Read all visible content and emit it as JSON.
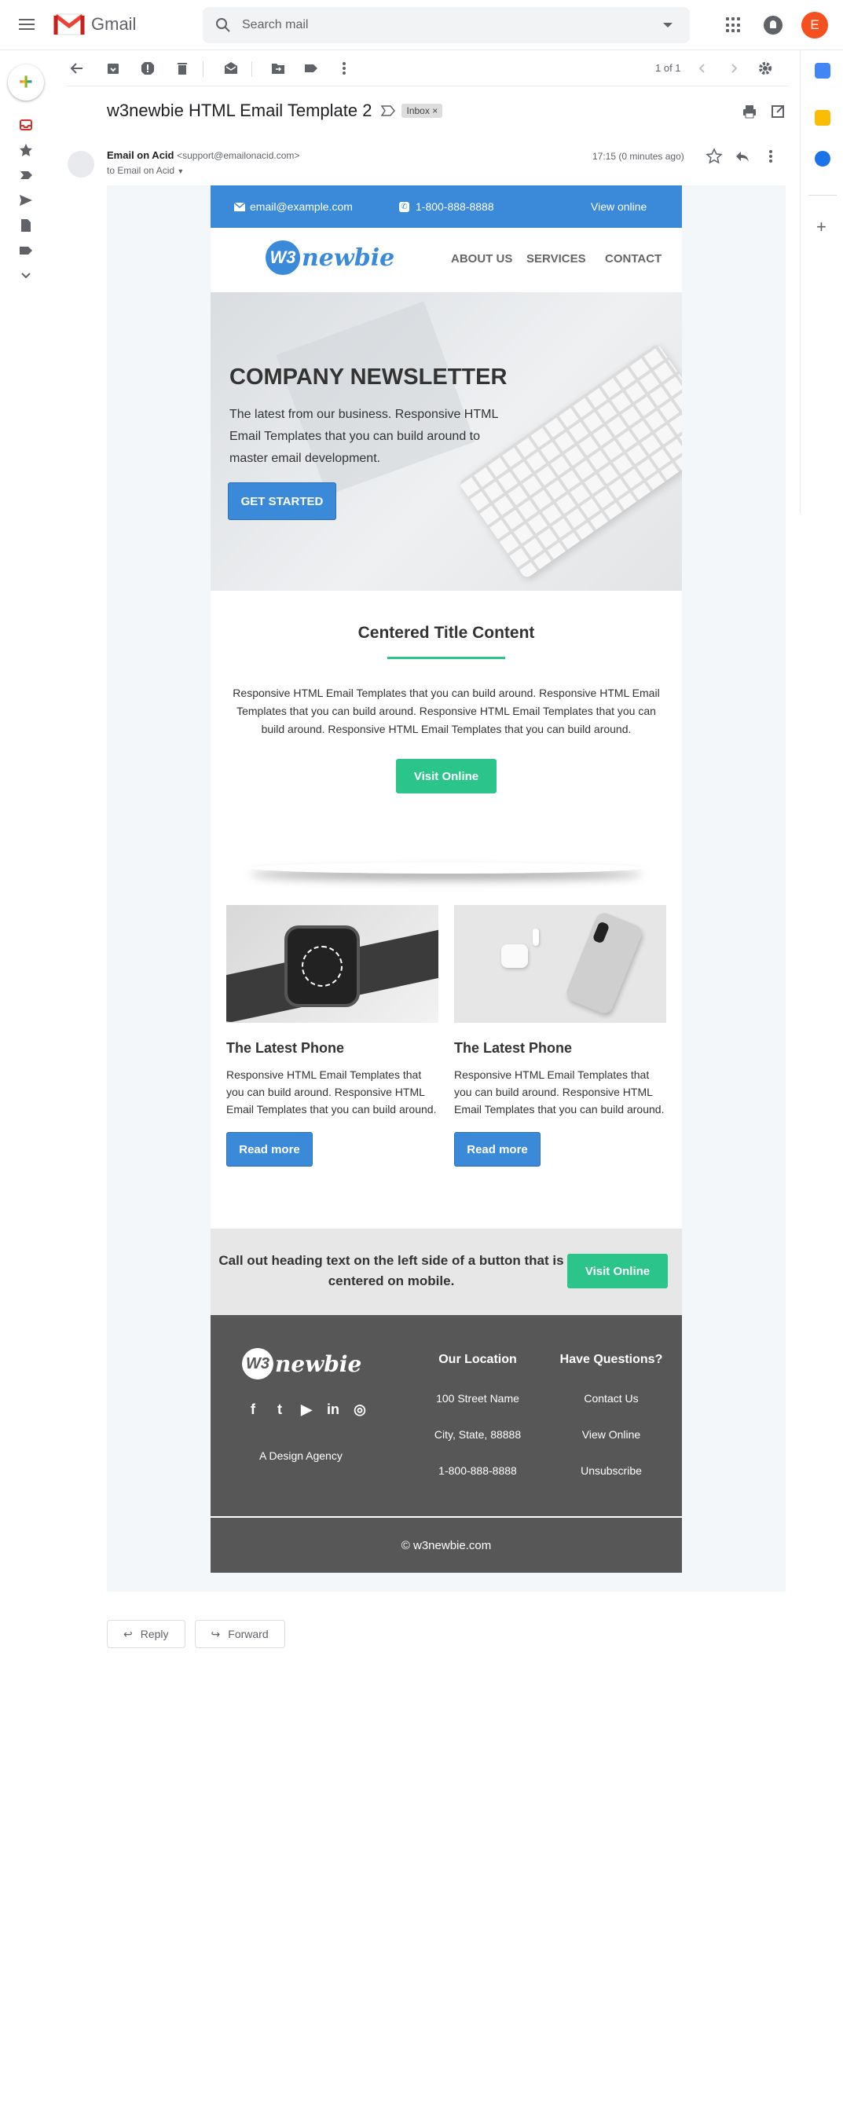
{
  "app": {
    "name": "Gmail"
  },
  "search": {
    "placeholder": "Search mail"
  },
  "account": {
    "initial": "E"
  },
  "pager": {
    "text": "1 of 1"
  },
  "message": {
    "subject": "w3newbie HTML Email Template 2",
    "label": "Inbox",
    "label_close": "×",
    "sender_name": "Email on Acid",
    "sender_email": "<support@emailonacid.com>",
    "to_line": "to Email on Acid",
    "time": "17:15 (0 minutes ago)"
  },
  "email": {
    "topbar": {
      "email": "email@example.com",
      "phone": "1-800-888-8888",
      "view_online": "View online"
    },
    "logo": {
      "badge": "W3",
      "text": "newbie"
    },
    "nav": [
      "ABOUT US",
      "SERVICES",
      "CONTACT"
    ],
    "hero": {
      "title": "COMPANY NEWSLETTER",
      "text": "The latest from our business. Responsive HTML Email Templates that you can build around to master email development.",
      "button": "GET STARTED"
    },
    "centered": {
      "title": "Centered Title Content",
      "text": "Responsive HTML Email Templates that you can build around. Responsive HTML Email Templates that you can build around. Responsive HTML Email Templates that you can build around. Responsive HTML Email Templates that you can build around.",
      "button": "Visit Online"
    },
    "columns": [
      {
        "title": "The Latest Phone",
        "text": "Responsive HTML Email Templates that you can build around. Responsive HTML Email Templates that you can build around.",
        "button": "Read more"
      },
      {
        "title": "The Latest Phone",
        "text": "Responsive HTML Email Templates that you can build around. Responsive HTML Email Templates that you can build around.",
        "button": "Read more"
      }
    ],
    "callout": {
      "text": "Call out heading text on the left side of a button that is centered on mobile.",
      "button": "Visit Online"
    },
    "footer": {
      "social": [
        "f",
        "t",
        "▶",
        "in",
        "◎"
      ],
      "agency": "A Design Agency",
      "location": {
        "title": "Our Location",
        "lines": [
          "100 Street Name",
          "City, State, 88888",
          "1-800-888-8888"
        ]
      },
      "questions": {
        "title": "Have Questions?",
        "lines": [
          "Contact Us",
          "View Online",
          "Unsubscribe"
        ]
      },
      "copyright": "© w3newbie.com"
    }
  },
  "actions": {
    "reply": "Reply",
    "forward": "Forward"
  },
  "colors": {
    "email_blue": "#3a8ad9",
    "email_green": "#2bc48a",
    "footer_gray": "#575757",
    "gmail_red": "#ea4335"
  }
}
